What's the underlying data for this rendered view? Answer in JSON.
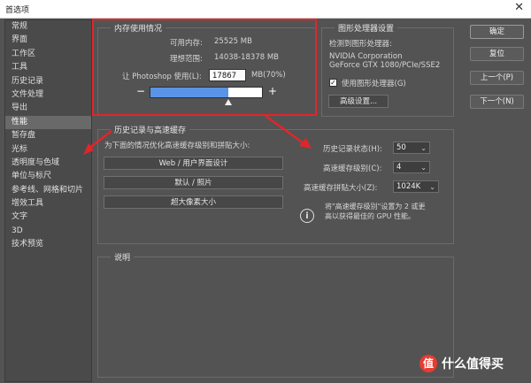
{
  "window": {
    "title": "首选项",
    "close_glyph": "✕"
  },
  "sidebar": {
    "items": [
      {
        "label": "常规"
      },
      {
        "label": "界面"
      },
      {
        "label": "工作区"
      },
      {
        "label": "工具"
      },
      {
        "label": "历史记录"
      },
      {
        "label": "文件处理"
      },
      {
        "label": "导出"
      },
      {
        "label": "性能"
      },
      {
        "label": "暂存盘"
      },
      {
        "label": "光标"
      },
      {
        "label": "透明度与色域"
      },
      {
        "label": "单位与标尺"
      },
      {
        "label": "参考线、网格和切片"
      },
      {
        "label": "增效工具"
      },
      {
        "label": "文字"
      },
      {
        "label": "3D"
      },
      {
        "label": "技术预览"
      }
    ],
    "selected_index": 7
  },
  "memory": {
    "title": "内存使用情况",
    "available_label": "可用内存:",
    "available_value": "25525 MB",
    "ideal_label": "理想范围:",
    "ideal_value": "14038-18378 MB",
    "usage_label": "让 Photoshop 使用(L):",
    "usage_value": "17867",
    "usage_unit": "MB(70%)",
    "minus": "−",
    "plus": "+",
    "slider_fraction": 0.7
  },
  "gpu": {
    "title": "图形处理器设置",
    "detected_label": "检测到图形处理器:",
    "vendor": "NVIDIA Corporation",
    "model": "GeForce GTX 1080/PCIe/SSE2",
    "use_gpu_label": "使用图形处理器(G)",
    "use_gpu_checked": true,
    "check_glyph": "✓",
    "advanced_button": "高级设置..."
  },
  "history_cache": {
    "title": "历史记录与高速缓存",
    "optimize_label": "为下面的情况优化高速缓存级别和拼贴大小:",
    "preset_buttons": [
      "Web / 用户界面设计",
      "默认 / 照片",
      "超大像素大小"
    ],
    "history_states_label": "历史记录状态(H):",
    "history_states_value": "50",
    "cache_levels_label": "高速缓存级别(C):",
    "cache_levels_value": "4",
    "tile_size_label": "高速缓存拼贴大小(Z):",
    "tile_size_value": "1024K",
    "info_glyph": "i",
    "chevron_glyph": "⌄",
    "note_line1": "将\"高速缓存级别\"设置为 2 或更",
    "note_line2": "高以获得最佳的 GPU 性能。"
  },
  "description": {
    "title": "说明"
  },
  "buttons": {
    "ok": "确定",
    "reset": "复位",
    "prev": "上一个(P)",
    "next": "下一个(N)"
  },
  "watermark": {
    "text": "什么值得买",
    "icon_glyph": "值"
  },
  "colors": {
    "highlight": "#e0262b",
    "slider_fill": "#5a94e6",
    "background": "#535353"
  }
}
